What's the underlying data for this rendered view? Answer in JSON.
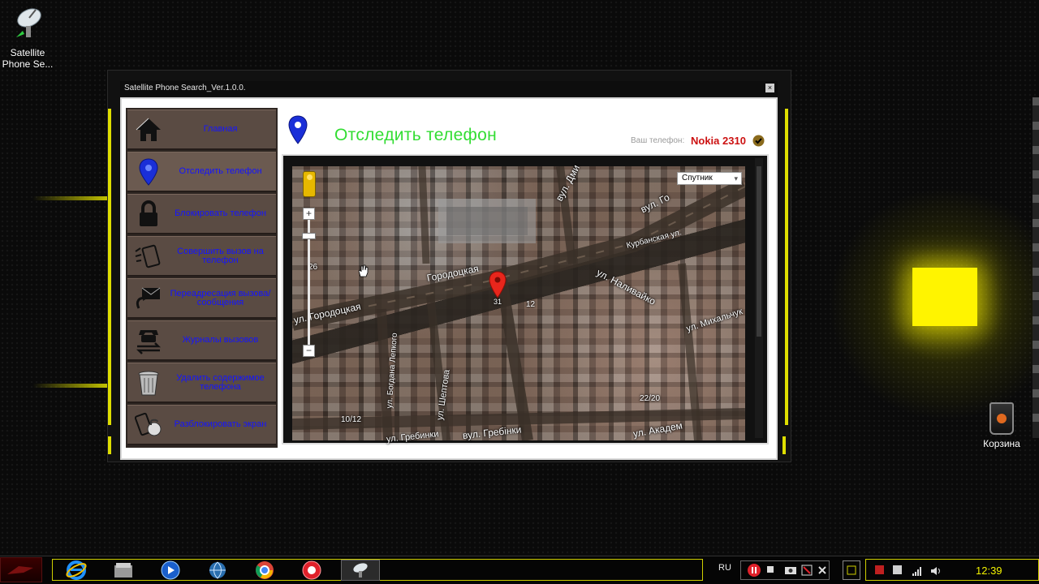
{
  "desktop": {
    "icons": [
      {
        "label": "Satellite Phone Se...",
        "icon": "satellite-dish-icon"
      },
      {
        "label": "Корзина",
        "icon": "recycle-bin-icon"
      }
    ]
  },
  "window": {
    "title": "Satellite Phone Search_Ver.1.0.0.",
    "close_glyph": "×"
  },
  "sidebar": {
    "items": [
      {
        "label": "Главная",
        "icon": "home-icon"
      },
      {
        "label": "Отследить телефон",
        "icon": "location-pin-icon",
        "active": true
      },
      {
        "label": "Блокировать телефон",
        "icon": "lock-icon"
      },
      {
        "label": "Совершить вызов на телефон",
        "icon": "phone-call-icon"
      },
      {
        "label": "Переадресация вызова/сообщения",
        "icon": "message-forward-icon"
      },
      {
        "label": "Журналы вызовов",
        "icon": "call-log-icon"
      },
      {
        "label": "Удалить содержимое телефона",
        "icon": "trash-icon"
      },
      {
        "label": "Разблокировать экран",
        "icon": "unlock-icon"
      }
    ]
  },
  "header": {
    "title": "Отследить телефон",
    "phone_label": "Ваш телефон:",
    "phone_model": "Nokia 2310"
  },
  "map": {
    "type_selector": "Спутник",
    "zoom_in": "+",
    "zoom_out": "−",
    "streets": [
      "Городоцкая",
      "ул. Городоцкая",
      "вул. Го",
      "вул. Дми",
      "Курбанская ул.",
      "ул. Наливайко",
      "ул. Михальчук",
      "ул. Шептова",
      "ул. Богдана Лепкого",
      "ул. Гребинки",
      "вул. Гребінки",
      "ул. Академ"
    ],
    "house_numbers": [
      "26",
      "12",
      "31",
      "10/12",
      "22/20"
    ]
  },
  "taskbar": {
    "language": "RU",
    "clock": "12:39"
  },
  "colors": {
    "accent_yellow": "#dede00",
    "title_green": "#33dd33",
    "nav_blue": "#1414ff",
    "phone_red": "#cc1111",
    "sidebar_brown": "#5a4b43"
  }
}
